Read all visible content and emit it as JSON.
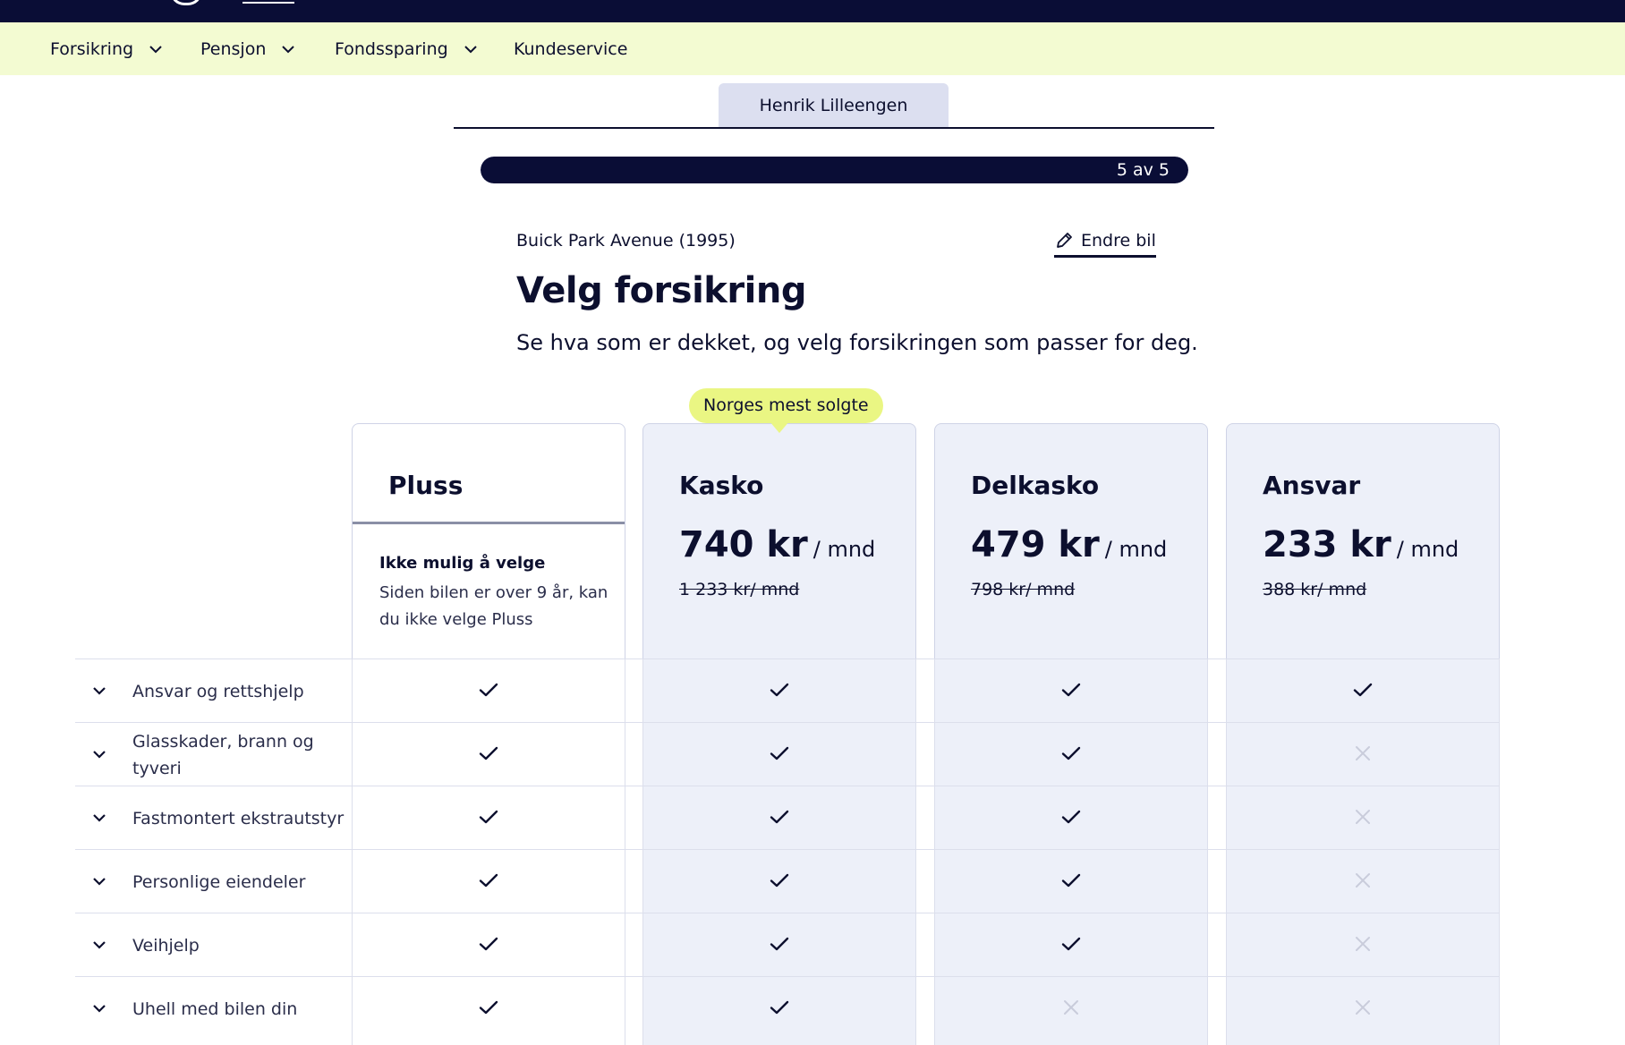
{
  "nav": {
    "items": [
      {
        "label": "Forsikring",
        "has_dropdown": true
      },
      {
        "label": "Pensjon",
        "has_dropdown": true
      },
      {
        "label": "Fondssparing",
        "has_dropdown": true
      },
      {
        "label": "Kundeservice",
        "has_dropdown": false
      }
    ]
  },
  "person_tab": {
    "label": "Henrik Lilleengen"
  },
  "progress": {
    "label": "5 av 5",
    "current": 5,
    "total": 5
  },
  "car": {
    "name": "Buick Park Avenue (1995)",
    "edit_label": "Endre bil"
  },
  "heading": "Velg forsikring",
  "lead": "Se hva som er dekket, og velg forsikringen som passer for deg.",
  "badge": "Norges mest solgte",
  "plans": [
    {
      "name": "Pluss",
      "available": false,
      "note_title": "Ikke mulig å velge",
      "note_text": "Siden bilen er over 9 år, kan du ikke velge Pluss"
    },
    {
      "name": "Kasko",
      "available": true,
      "price": "740 kr",
      "unit": "/ mnd",
      "old_price": "1 233 kr/ mnd"
    },
    {
      "name": "Delkasko",
      "available": true,
      "price": "479 kr",
      "unit": "/ mnd",
      "old_price": "798 kr/ mnd"
    },
    {
      "name": "Ansvar",
      "available": true,
      "price": "233 kr",
      "unit": "/ mnd",
      "old_price": "388 kr/ mnd"
    }
  ],
  "coverage": [
    {
      "label": "Ansvar og rettshjelp",
      "included": [
        true,
        true,
        true,
        true
      ]
    },
    {
      "label": "Glasskader, brann og tyveri",
      "included": [
        true,
        true,
        true,
        false
      ]
    },
    {
      "label": "Fastmontert ekstrautstyr",
      "included": [
        true,
        true,
        true,
        false
      ]
    },
    {
      "label": "Personlige eiendeler",
      "included": [
        true,
        true,
        true,
        false
      ]
    },
    {
      "label": "Veihjelp",
      "included": [
        true,
        true,
        true,
        false
      ]
    },
    {
      "label": "Uhell med bilen din",
      "included": [
        true,
        true,
        false,
        false
      ]
    }
  ],
  "icons": {
    "check": "check-icon",
    "cross": "cross-icon",
    "chevron": "chevron-down-icon",
    "pencil": "pencil-icon"
  },
  "colors": {
    "dark": "#0a0d36",
    "nav_bg": "#f3fbd2",
    "badge": "#eaf683",
    "card_blue": "#edf0f9"
  }
}
